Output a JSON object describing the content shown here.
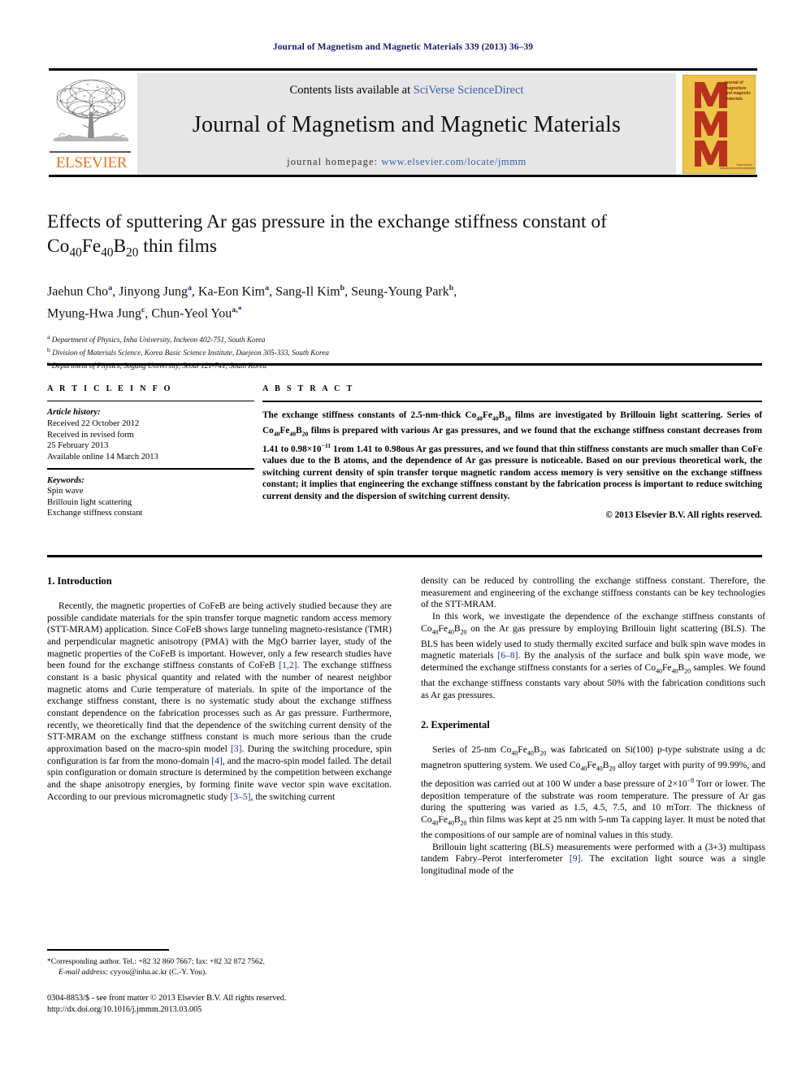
{
  "running_head": "Journal of Magnetism and Magnetic Materials 339 (2013) 36–39",
  "masthead": {
    "contents_prefix": "Contents lists available at ",
    "contents_link": "SciVerse ScienceDirect",
    "journal_title": "Journal of Magnetism and Magnetic Materials",
    "homepage_prefix": "journal homepage: ",
    "homepage_url": "www.elsevier.com/locate/jmmm",
    "publisher_name": "ELSEVIER",
    "cover_text": "journal of magnetism and magnetic materials",
    "cover_footer": "ScienceDirect\nwww.elsevier.com/locate/jmmm",
    "cover_letters": "MMM",
    "colors": {
      "elsevier_orange": "#E87722",
      "band_gray": "#e6e6e6",
      "cover_yellow": "#edc54b",
      "cover_red": "#b7311f",
      "link_blue": "#3b5fa8",
      "head_navy": "#1a1a6e"
    }
  },
  "title": {
    "line1": "Effects of sputtering Ar gas pressure in the exchange stiffness constant of",
    "line2_pre": "Co",
    "line2_sub1": "40",
    "line2_mid1": "Fe",
    "line2_sub2": "40",
    "line2_mid2": "B",
    "line2_sub3": "20",
    "line2_post": " thin films"
  },
  "authors": {
    "line1": "Jaehun Cho a, Jinyong Jung a, Ka-Eon Kim a, Sang-Il Kim b, Seung-Young Park b,",
    "line2": "Myung-Hwa Jung c, Chun-Yeol You a,*"
  },
  "affiliations": [
    {
      "marker": "a",
      "text": "Department of Physics, Inha University, Incheon 402-751, South Korea"
    },
    {
      "marker": "b",
      "text": "Division of Materials Science, Korea Basic Science Institute, Daejeon 305-333, South Korea"
    },
    {
      "marker": "c",
      "text": "Department of Physics, Sogang University, Seoul 121-741, South Korea"
    }
  ],
  "article_info": {
    "heading": "A R T I C L E  I N F O",
    "history_label": "Article history:",
    "history": [
      "Received 22 October 2012",
      "Received in revised form",
      "25 February 2013",
      "Available online 14 March 2013"
    ],
    "keywords_label": "Keywords:",
    "keywords": [
      "Spin wave",
      "Brillouin light scattering",
      "Exchange stiffness constant"
    ]
  },
  "abstract": {
    "heading": "A B S T R A C T",
    "copyright": "© 2013 Elsevier B.V. All rights reserved."
  },
  "sections": {
    "introduction_heading": "1.  Introduction",
    "experimental_heading": "2.  Experimental"
  },
  "footnote": {
    "corresponding": "*Corresponding author. Tel.: +82 32 860 7667; fax: +82 32 872 7562.",
    "email_label": "E-mail address:",
    "email": " cyyou@inha.ac.kr (C.-Y. You)."
  },
  "imprint": {
    "line1": "0304-8853/$ - see front matter © 2013 Elsevier B.V. All rights reserved.",
    "line2": "http://dx.doi.org/10.1016/j.jmmm.2013.03.005"
  }
}
